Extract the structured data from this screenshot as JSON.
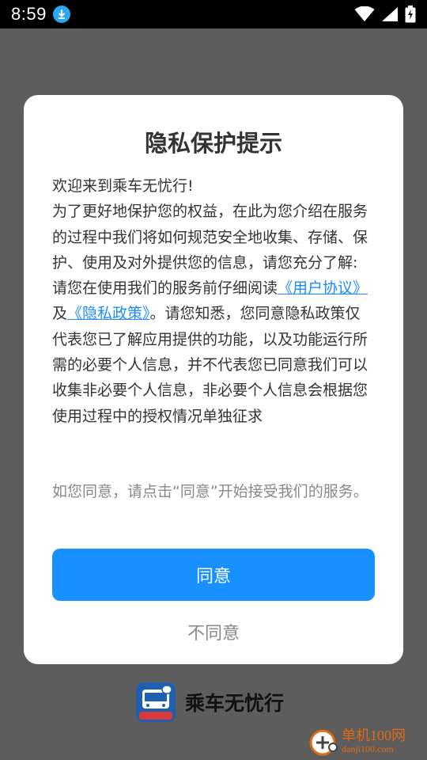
{
  "status_bar": {
    "time": "8:59",
    "icons": [
      "download-icon",
      "wifi-icon",
      "signal-icon",
      "battery-icon"
    ]
  },
  "dialog": {
    "title": "隐私保护提示",
    "welcome": "欢迎来到乘车无忧行!",
    "intro": "为了更好地保护您的权益，在此为您介绍在服务的过程中我们将如何规范安全地收集、存储、保护、使用及对外提供您的信息，请您充分了解:",
    "read_prefix": "请您在使用我们的服务前仔细阅读",
    "user_agreement_link": "《用户协议》",
    "and_text": "及",
    "privacy_policy_link": "《隐私政策》",
    "read_suffix": "。请您知悉，您同意隐私政策仅代表您已了解应用提供的功能，以及功能运行所需的必要个人信息，并不代表您已同意我们可以收集非必要个人信息，非必要个人信息会根据您使用过程中的授权情况单独征求",
    "hint": "如您同意，请点击“同意”开始接受我们的服务。",
    "agree_label": "同意",
    "disagree_label": "不同意"
  },
  "brand": {
    "name": "乘车无忧行",
    "logo_badge": "乘车无忧行"
  },
  "watermark": {
    "main": "单机100网",
    "sub": "danji100.com"
  },
  "colors": {
    "accent": "#1890ff",
    "link": "#1a8cff",
    "overlay": "#5d5d5d",
    "watermark": "#e06a12"
  }
}
